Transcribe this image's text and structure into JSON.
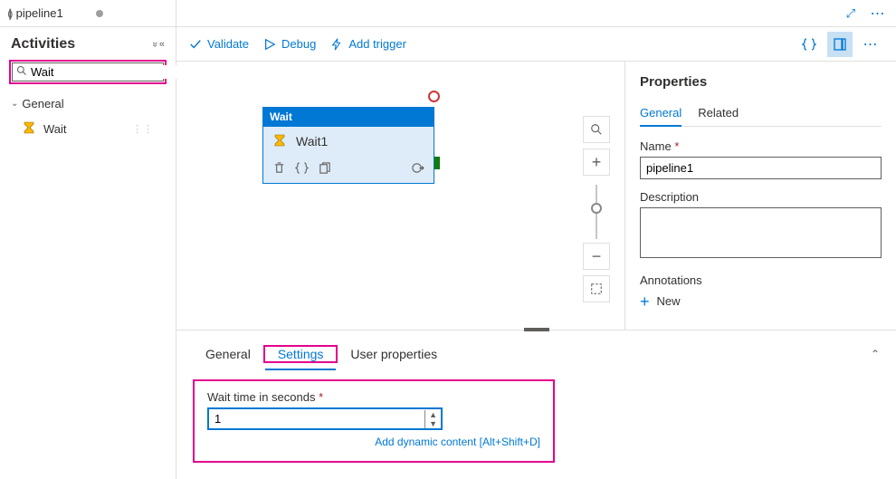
{
  "header": {
    "pipeline_tab": "pipeline1"
  },
  "sidebar": {
    "title": "Activities",
    "search_value": "Wait",
    "group": "General",
    "activity": "Wait"
  },
  "toolbar": {
    "validate": "Validate",
    "debug": "Debug",
    "add_trigger": "Add trigger"
  },
  "node": {
    "type": "Wait",
    "name": "Wait1"
  },
  "properties": {
    "heading": "Properties",
    "tab_general": "General",
    "tab_related": "Related",
    "name_label": "Name",
    "name_value": "pipeline1",
    "desc_label": "Description",
    "desc_value": "",
    "annotations_label": "Annotations",
    "new_label": "New"
  },
  "bottom": {
    "tab_general": "General",
    "tab_settings": "Settings",
    "tab_user_props": "User properties",
    "wait_label": "Wait time in seconds",
    "wait_value": "1",
    "dynamic_link": "Add dynamic content [Alt+Shift+D]"
  }
}
